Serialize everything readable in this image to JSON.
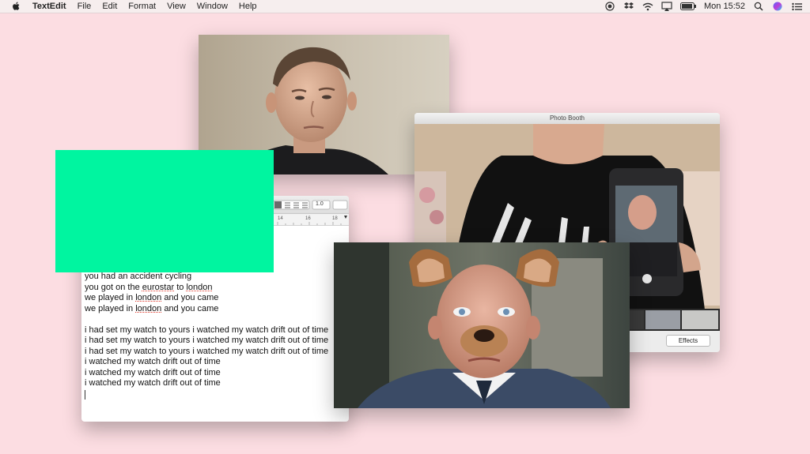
{
  "menubar": {
    "app_name": "TextEdit",
    "menus": [
      "File",
      "Edit",
      "Format",
      "View",
      "Window",
      "Help"
    ],
    "clock": "Mon 15:52",
    "status_icons": [
      "record-icon",
      "dropbox-icon",
      "wifi-icon",
      "airplay-icon",
      "battery-icon",
      "search-icon",
      "siri-icon",
      "list-icon"
    ]
  },
  "photobooth": {
    "title": "Photo Booth",
    "effects_label": "Effects"
  },
  "textedit": {
    "toolbar": {
      "line_spacing": "1.0"
    },
    "ruler": [
      "14",
      "16",
      "18"
    ],
    "lines": [
      {
        "parts": [
          {
            "t": "you had an accident cycling"
          }
        ]
      },
      {
        "parts": [
          {
            "t": "you got on the "
          },
          {
            "t": "eurostar",
            "sp": true
          },
          {
            "t": " to "
          },
          {
            "t": "london",
            "sp": true
          }
        ]
      },
      {
        "parts": [
          {
            "t": "we played in "
          },
          {
            "t": "london",
            "sp": true
          },
          {
            "t": " and you came"
          }
        ]
      },
      {
        "parts": [
          {
            "t": "we played in "
          },
          {
            "t": "london",
            "sp": true
          },
          {
            "t": " and you came"
          }
        ]
      },
      {
        "parts": []
      },
      {
        "parts": [
          {
            "t": "i had set my watch to yours i watched my watch drift out of time"
          }
        ]
      },
      {
        "parts": [
          {
            "t": "i had set my watch to yours i watched my watch drift out of time"
          }
        ]
      },
      {
        "parts": [
          {
            "t": "i had set my watch to yours i watched my watch drift out of time"
          }
        ]
      },
      {
        "parts": [
          {
            "t": "i watched my watch drift out of time"
          }
        ]
      },
      {
        "parts": [
          {
            "t": "i watched my watch drift out of time"
          }
        ]
      },
      {
        "parts": [
          {
            "t": "i watched my watch drift out of time"
          }
        ]
      }
    ]
  },
  "colors": {
    "desktop": "#fcdde2",
    "green_block": "#00f5a0"
  }
}
